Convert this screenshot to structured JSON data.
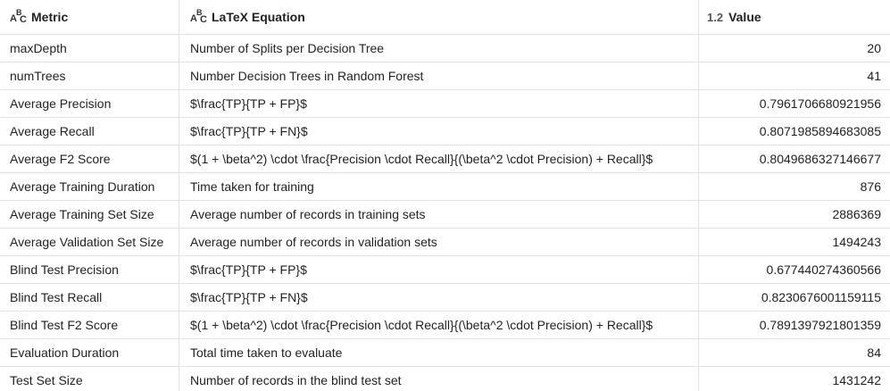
{
  "columns": [
    {
      "label": "Metric",
      "icon": "abc-text-icon"
    },
    {
      "label": "LaTeX Equation",
      "icon": "abc-text-icon"
    },
    {
      "label": "Value",
      "icon": "decimal-number-icon",
      "icon_text": "1.2"
    }
  ],
  "rows": [
    {
      "metric": "maxDepth",
      "equation": "Number of Splits per Decision Tree",
      "value": "20"
    },
    {
      "metric": "numTrees",
      "equation": "Number Decision Trees in Random Forest",
      "value": "41"
    },
    {
      "metric": "Average Precision",
      "equation": "$\\frac{TP}{TP + FP}$",
      "value": "0.7961706680921956"
    },
    {
      "metric": "Average Recall",
      "equation": "$\\frac{TP}{TP + FN}$",
      "value": "0.8071985894683085"
    },
    {
      "metric": "Average F2 Score",
      "equation": "$(1 + \\beta^2) \\cdot \\frac{Precision \\cdot Recall}{(\\beta^2 \\cdot Precision) + Recall}$",
      "value": "0.8049686327146677"
    },
    {
      "metric": "Average Training Duration",
      "equation": "Time taken for training",
      "value": "876"
    },
    {
      "metric": "Average Training Set Size",
      "equation": "Average number of records in training sets",
      "value": "2886369"
    },
    {
      "metric": "Average Validation Set Size",
      "equation": "Average number of records in validation sets",
      "value": "1494243"
    },
    {
      "metric": "Blind Test Precision",
      "equation": "$\\frac{TP}{TP + FP}$",
      "value": "0.677440274360566"
    },
    {
      "metric": "Blind Test Recall",
      "equation": "$\\frac{TP}{TP + FN}$",
      "value": "0.8230676001159115"
    },
    {
      "metric": "Blind Test F2 Score",
      "equation": "$(1 + \\beta^2) \\cdot \\frac{Precision \\cdot Recall}{(\\beta^2 \\cdot Precision) + Recall}$",
      "value": "0.7891397921801359"
    },
    {
      "metric": "Evaluation Duration",
      "equation": "Total time taken to evaluate",
      "value": "84"
    },
    {
      "metric": "Test Set Size",
      "equation": "Number of records in the blind test set",
      "value": "1431242"
    }
  ]
}
